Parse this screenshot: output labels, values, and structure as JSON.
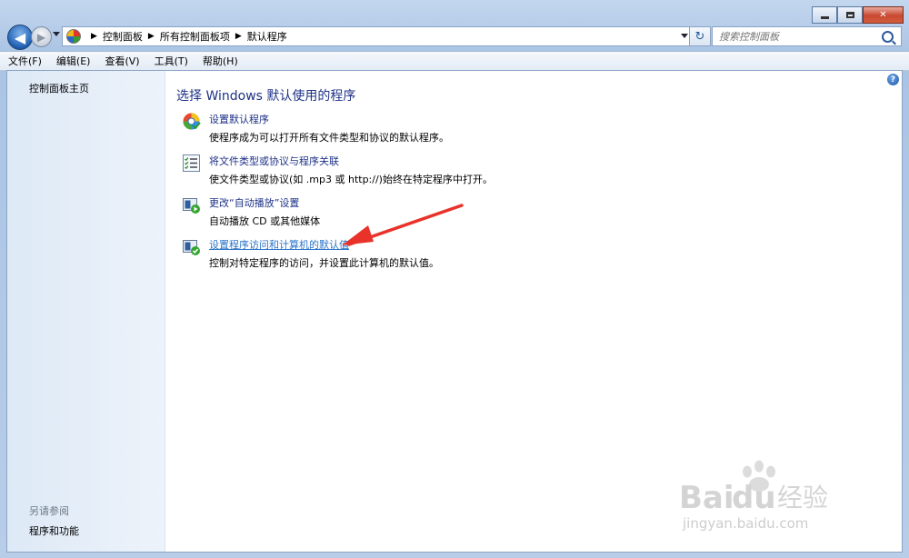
{
  "window": {
    "caption_buttons": [
      "minimize",
      "maximize",
      "close"
    ]
  },
  "address_bar": {
    "breadcrumbs": [
      "控制面板",
      "所有控制面板项",
      "默认程序"
    ]
  },
  "search": {
    "placeholder": "搜索控制面板"
  },
  "menu": [
    {
      "label": "文件(F)"
    },
    {
      "label": "编辑(E)"
    },
    {
      "label": "查看(V)"
    },
    {
      "label": "工具(T)"
    },
    {
      "label": "帮助(H)"
    }
  ],
  "sidebar": {
    "home_link": "控制面板主页",
    "see_also_label": "另请参阅",
    "see_also_links": [
      "程序和功能"
    ]
  },
  "main": {
    "title": "选择 Windows 默认使用的程序",
    "tasks": [
      {
        "icon": "default-programs-icon",
        "link": "设置默认程序",
        "desc": "使程序成为可以打开所有文件类型和协议的默认程序。"
      },
      {
        "icon": "file-association-icon",
        "link": "将文件类型或协议与程序关联",
        "desc": "使文件类型或协议(如 .mp3 或 http://)始终在特定程序中打开。"
      },
      {
        "icon": "autoplay-icon",
        "link": "更改“自动播放”设置",
        "desc": "自动播放 CD 或其他媒体"
      },
      {
        "icon": "program-access-icon",
        "link": "设置程序访问和计算机的默认值",
        "desc": "控制对特定程序的访问，并设置此计算机的默认值。"
      }
    ]
  },
  "watermark": {
    "brand": "Baidu经验",
    "url": "jingyan.baidu.com"
  },
  "colors": {
    "link": "#1e3287",
    "link_hover": "#2a73c9",
    "annotation_arrow": "#e8322a"
  }
}
